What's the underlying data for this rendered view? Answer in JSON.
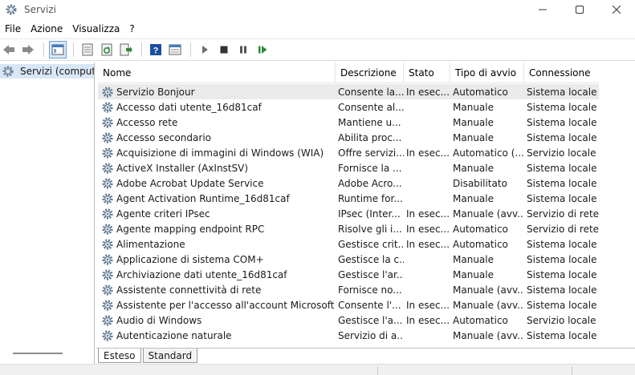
{
  "window": {
    "title": "Servizi"
  },
  "menu": [
    "File",
    "Azione",
    "Visualizza",
    "?"
  ],
  "tree": {
    "root_label": "Servizi (computer"
  },
  "columns": [
    "Nome",
    "Descrizione",
    "Stato",
    "Tipo di avvio",
    "Connessione"
  ],
  "rows": [
    {
      "name": "Servizio Bonjour",
      "desc": "Consente la...",
      "state": "In esec...",
      "start": "Automatico",
      "conn": "Sistema locale"
    },
    {
      "name": "Accesso dati utente_16d81caf",
      "desc": "Consente al...",
      "state": "",
      "start": "Manuale",
      "conn": "Sistema locale"
    },
    {
      "name": "Accesso rete",
      "desc": "Mantiene u...",
      "state": "",
      "start": "Manuale",
      "conn": "Sistema locale"
    },
    {
      "name": "Accesso secondario",
      "desc": "Abilita proc...",
      "state": "",
      "start": "Manuale",
      "conn": "Sistema locale"
    },
    {
      "name": "Acquisizione di immagini di Windows (WIA)",
      "desc": "Offre servizi...",
      "state": "In esec...",
      "start": "Automatico (...",
      "conn": "Servizio locale"
    },
    {
      "name": "ActiveX Installer (AxInstSV)",
      "desc": "Fornisce la ...",
      "state": "",
      "start": "Manuale",
      "conn": "Sistema locale"
    },
    {
      "name": "Adobe Acrobat Update Service",
      "desc": "Adobe Acro...",
      "state": "",
      "start": "Disabilitato",
      "conn": "Sistema locale"
    },
    {
      "name": "Agent Activation Runtime_16d81caf",
      "desc": "Runtime for...",
      "state": "",
      "start": "Manuale",
      "conn": "Sistema locale"
    },
    {
      "name": "Agente criteri IPsec",
      "desc": "IPsec (Inter...",
      "state": "In esec...",
      "start": "Manuale (avv...",
      "conn": "Servizio di rete"
    },
    {
      "name": "Agente mapping endpoint RPC",
      "desc": "Risolve gli i...",
      "state": "In esec...",
      "start": "Automatico",
      "conn": "Servizio di rete"
    },
    {
      "name": "Alimentazione",
      "desc": "Gestisce crit...",
      "state": "In esec...",
      "start": "Automatico",
      "conn": "Sistema locale"
    },
    {
      "name": "Applicazione di sistema COM+",
      "desc": "Gestisce la c...",
      "state": "",
      "start": "Manuale",
      "conn": "Sistema locale"
    },
    {
      "name": "Archiviazione dati utente_16d81caf",
      "desc": "Gestisce l'ar...",
      "state": "",
      "start": "Manuale",
      "conn": "Sistema locale"
    },
    {
      "name": "Assistente connettività di rete",
      "desc": "Fornisce no...",
      "state": "",
      "start": "Manuale (avv...",
      "conn": "Sistema locale"
    },
    {
      "name": "Assistente per l'accesso all'account Microsoft",
      "desc": "Consente l'...",
      "state": "In esec...",
      "start": "Manuale (avv...",
      "conn": "Sistema locale"
    },
    {
      "name": "Audio di Windows",
      "desc": "Gestisce l'a...",
      "state": "In esec...",
      "start": "Automatico",
      "conn": "Servizio locale"
    },
    {
      "name": "Autenticazione naturale",
      "desc": "Servizio di a...",
      "state": "",
      "start": "Manuale (avv...",
      "conn": "Sistema locale"
    }
  ],
  "tabs": [
    "Esteso",
    "Standard"
  ],
  "icons": [
    "services-icon",
    "back-arrow-icon",
    "forward-arrow-icon",
    "console-tree-icon",
    "properties-icon",
    "refresh-icon",
    "export-list-icon",
    "help-icon",
    "details-pane-icon",
    "play-icon",
    "stop-icon",
    "pause-icon",
    "restart-icon",
    "gear-icon"
  ],
  "colors": {
    "selection": "#d9e6f5",
    "row_selected": "#eaeaea",
    "play_green": "#2e8b3a",
    "help_blue": "#1a4fa0"
  }
}
